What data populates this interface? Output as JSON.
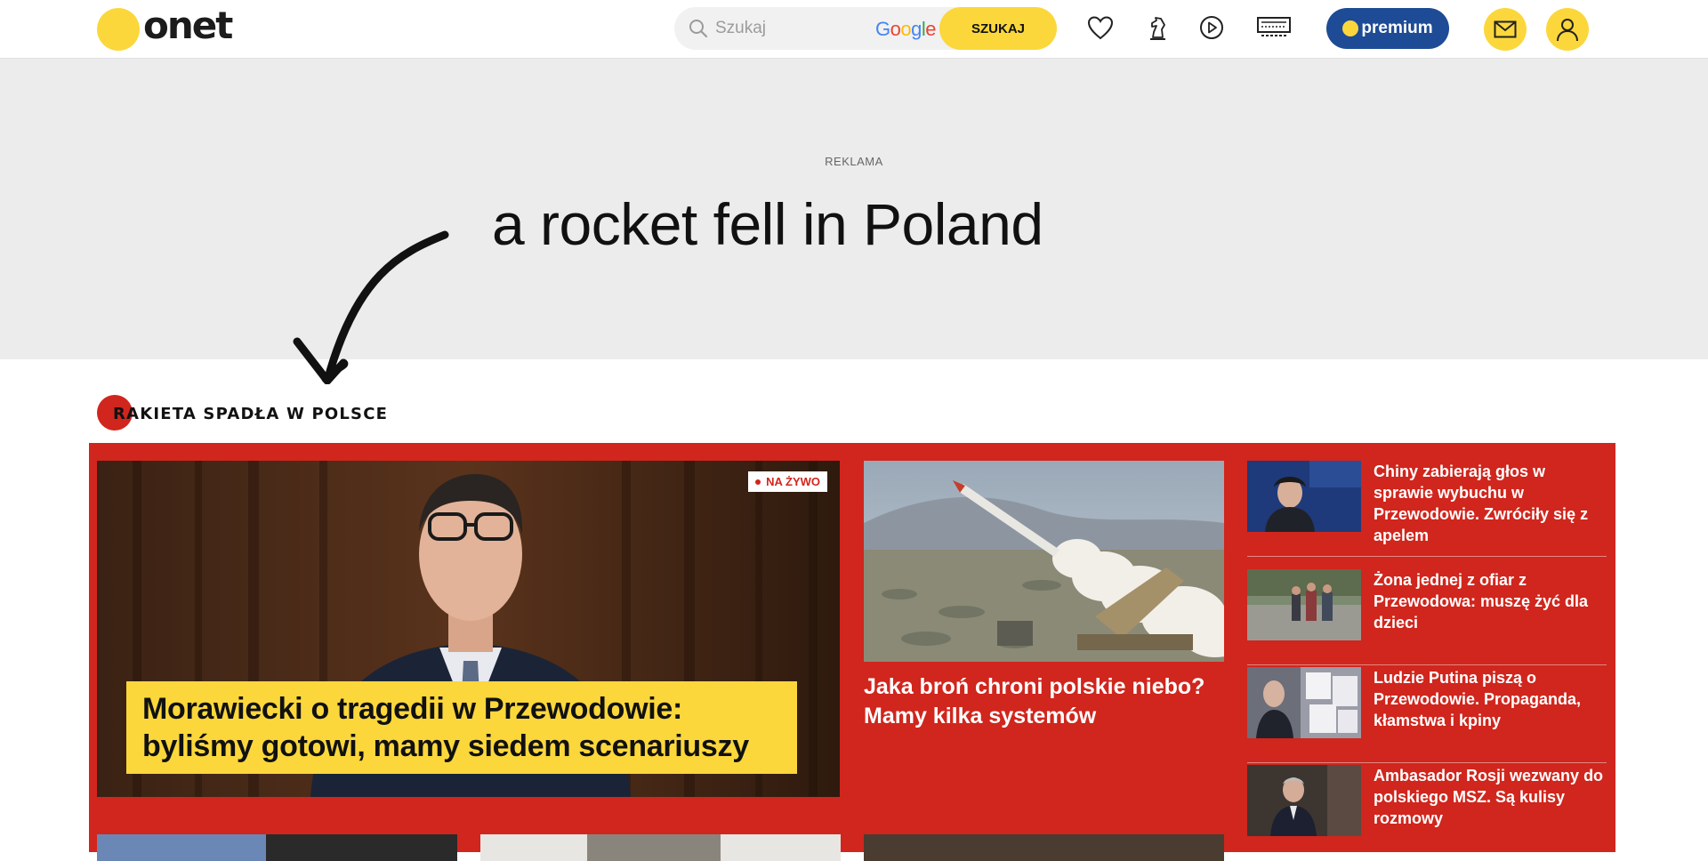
{
  "header": {
    "logo_text": "onet",
    "search": {
      "placeholder": "Szukaj",
      "button_label": "SZUKAJ",
      "provider": "Google"
    },
    "premium_label": "premium"
  },
  "ad": {
    "label": "REKLAMA",
    "caption": "a rocket fell in Poland"
  },
  "section": {
    "title": "RAKIETA SPADŁA W POLSCE",
    "main": {
      "badge": "NA ŻYWO",
      "headline": "Morawiecki o tragedii w Przewodowie: byliśmy gotowi, mamy siedem scenariuszy"
    },
    "middle": {
      "headline": "Jaka broń chroni polskie niebo? Mamy kilka systemów"
    },
    "side_items": [
      {
        "headline": "Chiny zabierają głos w sprawie wybuchu w Przewodowie. Zwróciły się z apelem"
      },
      {
        "headline": "Żona jednej z ofiar z Przewodowa: muszę żyć dla dzieci"
      },
      {
        "headline": "Ludzie Putina piszą o Przewodowie. Propaganda, kłamstwa i kpiny"
      },
      {
        "headline": "Ambasador Rosji wezwany do polskiego MSZ. Są kulisy rozmowy"
      }
    ]
  },
  "colors": {
    "brand_yellow": "#fbd73b",
    "section_red": "#d0261d",
    "premium_blue": "#1e4b95"
  }
}
